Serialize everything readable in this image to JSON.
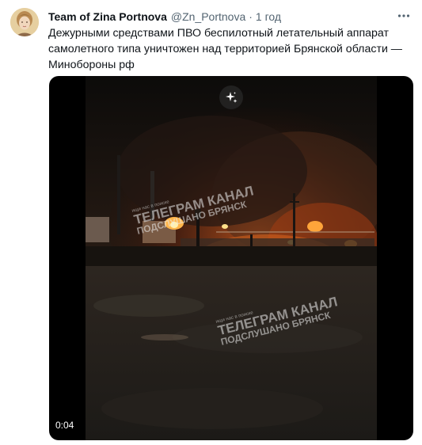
{
  "tweet": {
    "author_name": "Team of Zina Portnova",
    "author_handle": "@Zn_Portnova",
    "separator": "·",
    "timestamp": "1 год",
    "more_icon": "more-horizontal-icon",
    "text_line1": "Дежурными средствами ПВО беспилотный летательный аппарат",
    "text_line2": "самолетного типа уничтожен над территорией Брянской области —",
    "text_line3": "Минобороны рф"
  },
  "media": {
    "type": "video",
    "duration": "0:04",
    "sparkle_icon": "sparkle-icon",
    "watermarks": [
      {
        "small": "ищи нас в поиске",
        "line1": "ТЕЛЕГРАМ КАНАЛ",
        "line2": "ПОДСЛУШАНО БРЯНСК"
      },
      {
        "small": "ищи нас в поиске",
        "line1": "ТЕЛЕГРАМ КАНАЛ",
        "line2": "ПОДСЛУШАНО БРЯНСК"
      }
    ]
  },
  "colors": {
    "text_primary": "#0f1419",
    "text_secondary": "#536471",
    "fire": "#ff8a1c",
    "smoke": "#2a1c14"
  }
}
